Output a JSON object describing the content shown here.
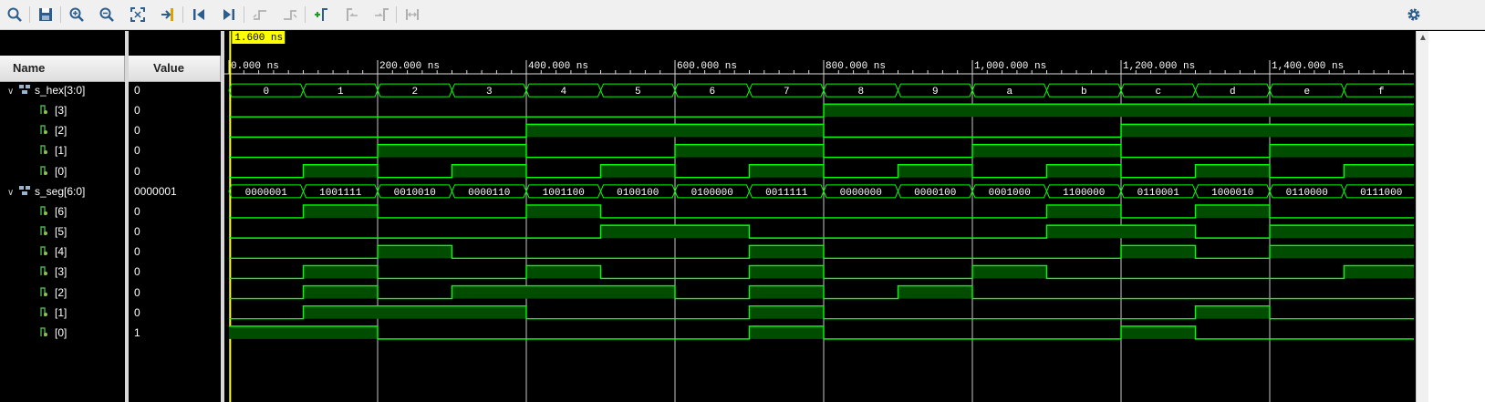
{
  "toolbar": {
    "buttons": [
      {
        "id": "search",
        "icon": "search-icon"
      },
      {
        "id": "save",
        "icon": "save-icon"
      },
      {
        "id": "zoom-in",
        "icon": "zoom-in-icon"
      },
      {
        "id": "zoom-out",
        "icon": "zoom-out-icon"
      },
      {
        "id": "zoom-fit",
        "icon": "zoom-fit-icon"
      },
      {
        "id": "go-to-cursor",
        "icon": "go-to-cursor-icon"
      },
      {
        "id": "go-to-start",
        "icon": "go-to-start-icon"
      },
      {
        "id": "go-to-end",
        "icon": "go-to-end-icon"
      },
      {
        "id": "previous-transition",
        "icon": "previous-transition-icon"
      },
      {
        "id": "next-transition",
        "icon": "next-transition-icon"
      },
      {
        "id": "add-marker",
        "icon": "add-marker-icon"
      },
      {
        "id": "previous-marker",
        "icon": "previous-marker-icon"
      },
      {
        "id": "next-marker",
        "icon": "next-marker-icon"
      },
      {
        "id": "swap-cursors",
        "icon": "swap-cursors-icon"
      },
      {
        "id": "settings",
        "icon": "gear-icon"
      }
    ]
  },
  "panel": {
    "name_header": "Name",
    "value_header": "Value"
  },
  "cursor": {
    "label": "1.600 ns",
    "time_ns": 1.6,
    "color": "#ffff00"
  },
  "timeline": {
    "range_ns": [
      0,
      1600
    ],
    "major_ticks": [
      {
        "t": 0,
        "label": "0.000 ns"
      },
      {
        "t": 200,
        "label": "200.000 ns"
      },
      {
        "t": 400,
        "label": "400.000 ns"
      },
      {
        "t": 600,
        "label": "600.000 ns"
      },
      {
        "t": 800,
        "label": "800.000 ns"
      },
      {
        "t": 1000,
        "label": "1,000.000 ns"
      },
      {
        "t": 1200,
        "label": "1,200.000 ns"
      },
      {
        "t": 1400,
        "label": "1,400.000 ns"
      }
    ],
    "step_ns": 100
  },
  "colors": {
    "wave": "#00ff00",
    "fill": "#004d00",
    "background": "#000000",
    "gridline": "#c8c8c8",
    "header_bg": "#dedede"
  },
  "signals": [
    {
      "name": "s_hex[3:0]",
      "value": "0",
      "bus": true,
      "expanded": true,
      "segments": [
        "0",
        "1",
        "2",
        "3",
        "4",
        "5",
        "6",
        "7",
        "8",
        "9",
        "a",
        "b",
        "c",
        "d",
        "e",
        "f"
      ]
    },
    {
      "name": "[3]",
      "value": "0",
      "bits": [
        0,
        0,
        0,
        0,
        0,
        0,
        0,
        0,
        1,
        1,
        1,
        1,
        1,
        1,
        1,
        1
      ]
    },
    {
      "name": "[2]",
      "value": "0",
      "bits": [
        0,
        0,
        0,
        0,
        1,
        1,
        1,
        1,
        0,
        0,
        0,
        0,
        1,
        1,
        1,
        1
      ]
    },
    {
      "name": "[1]",
      "value": "0",
      "bits": [
        0,
        0,
        1,
        1,
        0,
        0,
        1,
        1,
        0,
        0,
        1,
        1,
        0,
        0,
        1,
        1
      ]
    },
    {
      "name": "[0]",
      "value": "0",
      "bits": [
        0,
        1,
        0,
        1,
        0,
        1,
        0,
        1,
        0,
        1,
        0,
        1,
        0,
        1,
        0,
        1
      ]
    },
    {
      "name": "s_seg[6:0]",
      "value": "0000001",
      "bus": true,
      "expanded": true,
      "segments": [
        "0000001",
        "1001111",
        "0010010",
        "0000110",
        "1001100",
        "0100100",
        "0100000",
        "0011111",
        "0000000",
        "0000100",
        "0001000",
        "1100000",
        "0110001",
        "1000010",
        "0110000",
        "0111000"
      ]
    },
    {
      "name": "[6]",
      "value": "0",
      "bits": [
        0,
        1,
        0,
        0,
        1,
        0,
        0,
        0,
        0,
        0,
        0,
        1,
        0,
        1,
        0,
        0
      ]
    },
    {
      "name": "[5]",
      "value": "0",
      "bits": [
        0,
        0,
        0,
        0,
        0,
        1,
        1,
        0,
        0,
        0,
        0,
        1,
        1,
        0,
        1,
        1
      ]
    },
    {
      "name": "[4]",
      "value": "0",
      "bits": [
        0,
        0,
        1,
        0,
        0,
        0,
        0,
        1,
        0,
        0,
        0,
        0,
        1,
        0,
        1,
        1
      ]
    },
    {
      "name": "[3]",
      "value": "0",
      "bits": [
        0,
        1,
        0,
        0,
        1,
        0,
        0,
        1,
        0,
        0,
        1,
        0,
        0,
        0,
        0,
        1
      ]
    },
    {
      "name": "[2]",
      "value": "0",
      "bits": [
        0,
        1,
        0,
        1,
        1,
        1,
        0,
        1,
        0,
        1,
        0,
        0,
        0,
        0,
        0,
        0
      ]
    },
    {
      "name": "[1]",
      "value": "0",
      "bits": [
        0,
        1,
        1,
        1,
        0,
        0,
        0,
        1,
        0,
        0,
        0,
        0,
        0,
        1,
        0,
        0
      ]
    },
    {
      "name": "[0]",
      "value": "1",
      "bits": [
        1,
        1,
        0,
        0,
        0,
        0,
        0,
        1,
        0,
        0,
        0,
        0,
        1,
        0,
        0,
        0
      ]
    }
  ]
}
